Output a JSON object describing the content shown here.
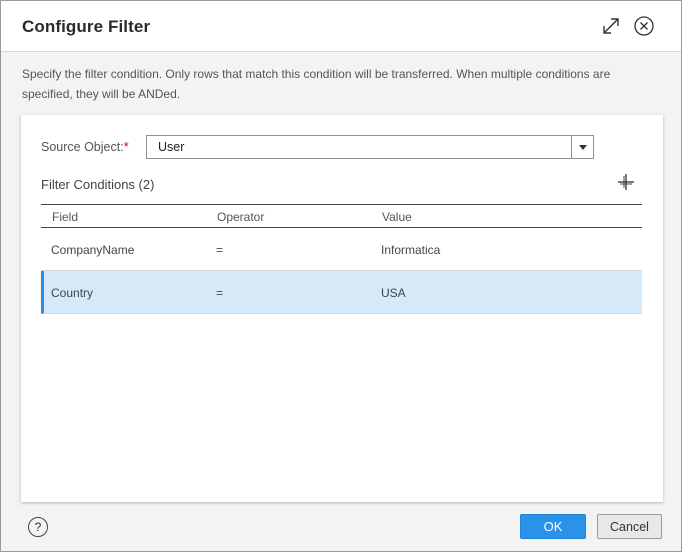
{
  "dialog": {
    "title": "Configure Filter",
    "description": "Specify the filter condition. Only rows that match this condition will be transferred. When multiple conditions are specified, they will be ANDed."
  },
  "source": {
    "label": "Source Object:",
    "required_mark": "*",
    "value": "User"
  },
  "filter_conditions": {
    "title": "Filter Conditions (2)",
    "columns": [
      "Field",
      "Operator",
      "Value"
    ],
    "rows": [
      {
        "field": "CompanyName",
        "operator": "=",
        "value": "Informatica",
        "selected": false
      },
      {
        "field": "Country",
        "operator": "=",
        "value": "USA",
        "selected": true
      }
    ]
  },
  "footer": {
    "help_label": "?",
    "ok_label": "OK",
    "cancel_label": "Cancel"
  },
  "colors": {
    "primary_button": "#2b92ea",
    "selected_row": "#d6e9f8",
    "selected_accent": "#2b8ee6",
    "required": "#d0021b"
  },
  "icons": {
    "expand": "expand-diagonal-arrows-icon",
    "close": "circle-x-icon",
    "add": "plus-icon",
    "dropdown": "triangle-down-icon",
    "help": "circle-question-icon"
  }
}
